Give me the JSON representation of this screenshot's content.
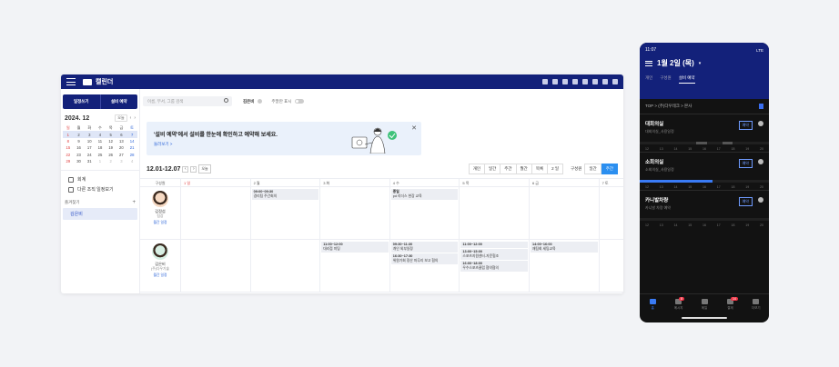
{
  "desktop": {
    "app_title": "캘린더",
    "sidebar": {
      "tab_calendar": "일정쓰기",
      "tab_booking": "설비 예약",
      "mini_cal": {
        "year_month": "2024. 12",
        "today": "오늘",
        "weekdays": [
          "일",
          "월",
          "화",
          "수",
          "목",
          "금",
          "토"
        ],
        "weeks": [
          [
            "1",
            "2",
            "3",
            "4",
            "5",
            "6",
            "7"
          ],
          [
            "8",
            "9",
            "10",
            "11",
            "12",
            "13",
            "14"
          ],
          [
            "15",
            "16",
            "17",
            "18",
            "19",
            "20",
            "21"
          ],
          [
            "22",
            "23",
            "24",
            "25",
            "26",
            "27",
            "28"
          ],
          [
            "29",
            "30",
            "31",
            "1",
            "2",
            "3",
            "4"
          ]
        ]
      },
      "link_team": "회계",
      "link_other": "다른 조직 일정보기",
      "favorites_label": "즐겨찾기",
      "favorite_item": "김은비"
    },
    "search_placeholder": "이름, 부서, 그룹 검색",
    "filter_name": "김은비",
    "toggle_label": "주말만 표시",
    "banner": {
      "text": "'설비 예약'에서 설비를 한눈에 확인하고 예약해 보세요.",
      "link": "둘러보기 >"
    },
    "range": "12.01-12.07",
    "today_btn": "오늘",
    "view_buttons": [
      "개인",
      "일간",
      "주간",
      "월간",
      "목록"
    ],
    "period_select": "2 일",
    "group_label": "구성원",
    "group_buttons": [
      "일간",
      "주간"
    ],
    "grid": {
      "head": [
        "구성원",
        "1 일",
        "2 월",
        "3 화",
        "4 수",
        "5 목",
        "6 금",
        "7 토"
      ],
      "rows": [
        {
          "name": "김정섭",
          "role": "팀장",
          "links": "월간  일정",
          "events": [
            [],
            [],
            [
              {
                "time": "09:00~09:30",
                "title": "경리팀 주간회의"
              }
            ],
            [],
            [
              {
                "time": "종일",
                "title": "pd 리더스 현장 교육"
              }
            ],
            [],
            [],
            []
          ]
        },
        {
          "name": "김은비",
          "role": "(주)다우기술",
          "links": "월간  일정",
          "events": [
            [],
            [],
            [],
            [
              {
                "time": "11:00~12:00",
                "title": "대리점 미팅"
              }
            ],
            [
              {
                "time": "09:30~11:30",
                "title": "개인 외부일정"
              },
              {
                "time": "16:30~17:30",
                "title": "위원기회 정산 마무리 보고 협의"
              }
            ],
            [
              {
                "time": "11:00~12:00",
                "title": ""
              },
              {
                "time": "13:00~15:00",
                "title": "스포츠지원센터-자문협조"
              },
              {
                "time": "16:00~18:00",
                "title": "우수스포츠클럽 협약협의"
              }
            ],
            [
              {
                "time": "14:00~16:00",
                "title": "재팀회 세팅교육"
              }
            ],
            []
          ]
        }
      ]
    }
  },
  "phone": {
    "status_time": "11:07",
    "status_right": "LTE",
    "title": "1월 2일 (목)",
    "tabs": [
      "개인",
      "구성원",
      "설비 예약"
    ],
    "breadcrumb": "TOP > (주)다우테크 > 본사",
    "rooms": [
      {
        "name": "대회의실",
        "sub": "대회의실_사용일정",
        "btn": "예약"
      },
      {
        "name": "소회의실",
        "sub": "소회의실_사용일정",
        "btn": "예약"
      },
      {
        "name": "카니발차량",
        "sub": "카니발 차량 예약",
        "btn": "예약"
      }
    ],
    "ticks": [
      "12",
      "13",
      "14",
      "15",
      "16",
      "17",
      "18",
      "19",
      "20"
    ],
    "nav": [
      {
        "label": "홈",
        "badge": ""
      },
      {
        "label": "메시지",
        "badge": "8"
      },
      {
        "label": "메일",
        "badge": ""
      },
      {
        "label": "결재",
        "badge": "14"
      },
      {
        "label": "더보기",
        "badge": ""
      }
    ],
    "accent": "#3a7bf5"
  },
  "colors": {
    "brand": "#13217a",
    "accent": "#2b8ff0",
    "sunday": "#e03b3b"
  }
}
